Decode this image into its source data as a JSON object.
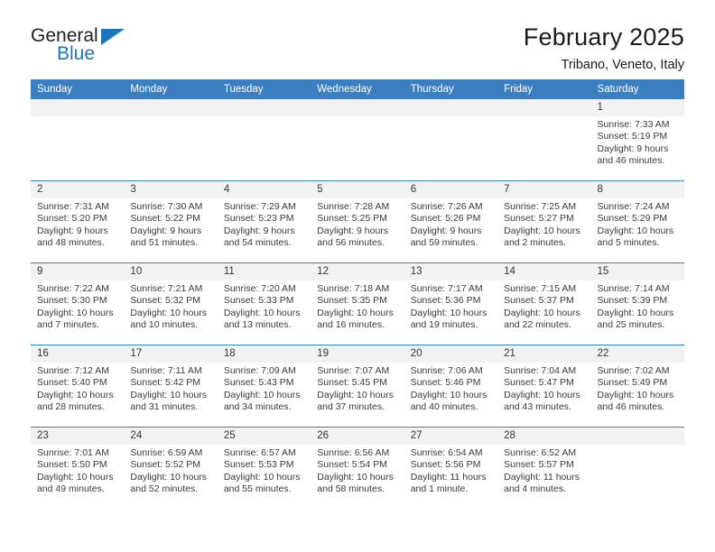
{
  "brand": {
    "name_part1": "General",
    "name_part2": "Blue",
    "triangle_color": "#1b75bb"
  },
  "header": {
    "title": "February 2025",
    "subtitle": "Tribano, Veneto, Italy"
  },
  "theme": {
    "header_blue": "#3c7fc1",
    "daynum_band": "#f2f2f2",
    "text": "#3a3a3a"
  },
  "weekday_headers": [
    "Sunday",
    "Monday",
    "Tuesday",
    "Wednesday",
    "Thursday",
    "Friday",
    "Saturday"
  ],
  "weeks": [
    [
      {
        "day": "",
        "sunrise": "",
        "sunset": "",
        "daylight1": "",
        "daylight2": "",
        "blank": true
      },
      {
        "day": "",
        "sunrise": "",
        "sunset": "",
        "daylight1": "",
        "daylight2": "",
        "blank": true
      },
      {
        "day": "",
        "sunrise": "",
        "sunset": "",
        "daylight1": "",
        "daylight2": "",
        "blank": true
      },
      {
        "day": "",
        "sunrise": "",
        "sunset": "",
        "daylight1": "",
        "daylight2": "",
        "blank": true
      },
      {
        "day": "",
        "sunrise": "",
        "sunset": "",
        "daylight1": "",
        "daylight2": "",
        "blank": true
      },
      {
        "day": "",
        "sunrise": "",
        "sunset": "",
        "daylight1": "",
        "daylight2": "",
        "blank": true
      },
      {
        "day": "1",
        "sunrise": "Sunrise: 7:33 AM",
        "sunset": "Sunset: 5:19 PM",
        "daylight1": "Daylight: 9 hours",
        "daylight2": "and 46 minutes.",
        "blank": false
      }
    ],
    [
      {
        "day": "2",
        "sunrise": "Sunrise: 7:31 AM",
        "sunset": "Sunset: 5:20 PM",
        "daylight1": "Daylight: 9 hours",
        "daylight2": "and 48 minutes.",
        "blank": false
      },
      {
        "day": "3",
        "sunrise": "Sunrise: 7:30 AM",
        "sunset": "Sunset: 5:22 PM",
        "daylight1": "Daylight: 9 hours",
        "daylight2": "and 51 minutes.",
        "blank": false
      },
      {
        "day": "4",
        "sunrise": "Sunrise: 7:29 AM",
        "sunset": "Sunset: 5:23 PM",
        "daylight1": "Daylight: 9 hours",
        "daylight2": "and 54 minutes.",
        "blank": false
      },
      {
        "day": "5",
        "sunrise": "Sunrise: 7:28 AM",
        "sunset": "Sunset: 5:25 PM",
        "daylight1": "Daylight: 9 hours",
        "daylight2": "and 56 minutes.",
        "blank": false
      },
      {
        "day": "6",
        "sunrise": "Sunrise: 7:26 AM",
        "sunset": "Sunset: 5:26 PM",
        "daylight1": "Daylight: 9 hours",
        "daylight2": "and 59 minutes.",
        "blank": false
      },
      {
        "day": "7",
        "sunrise": "Sunrise: 7:25 AM",
        "sunset": "Sunset: 5:27 PM",
        "daylight1": "Daylight: 10 hours",
        "daylight2": "and 2 minutes.",
        "blank": false
      },
      {
        "day": "8",
        "sunrise": "Sunrise: 7:24 AM",
        "sunset": "Sunset: 5:29 PM",
        "daylight1": "Daylight: 10 hours",
        "daylight2": "and 5 minutes.",
        "blank": false
      }
    ],
    [
      {
        "day": "9",
        "sunrise": "Sunrise: 7:22 AM",
        "sunset": "Sunset: 5:30 PM",
        "daylight1": "Daylight: 10 hours",
        "daylight2": "and 7 minutes.",
        "blank": false
      },
      {
        "day": "10",
        "sunrise": "Sunrise: 7:21 AM",
        "sunset": "Sunset: 5:32 PM",
        "daylight1": "Daylight: 10 hours",
        "daylight2": "and 10 minutes.",
        "blank": false
      },
      {
        "day": "11",
        "sunrise": "Sunrise: 7:20 AM",
        "sunset": "Sunset: 5:33 PM",
        "daylight1": "Daylight: 10 hours",
        "daylight2": "and 13 minutes.",
        "blank": false
      },
      {
        "day": "12",
        "sunrise": "Sunrise: 7:18 AM",
        "sunset": "Sunset: 5:35 PM",
        "daylight1": "Daylight: 10 hours",
        "daylight2": "and 16 minutes.",
        "blank": false
      },
      {
        "day": "13",
        "sunrise": "Sunrise: 7:17 AM",
        "sunset": "Sunset: 5:36 PM",
        "daylight1": "Daylight: 10 hours",
        "daylight2": "and 19 minutes.",
        "blank": false
      },
      {
        "day": "14",
        "sunrise": "Sunrise: 7:15 AM",
        "sunset": "Sunset: 5:37 PM",
        "daylight1": "Daylight: 10 hours",
        "daylight2": "and 22 minutes.",
        "blank": false
      },
      {
        "day": "15",
        "sunrise": "Sunrise: 7:14 AM",
        "sunset": "Sunset: 5:39 PM",
        "daylight1": "Daylight: 10 hours",
        "daylight2": "and 25 minutes.",
        "blank": false
      }
    ],
    [
      {
        "day": "16",
        "sunrise": "Sunrise: 7:12 AM",
        "sunset": "Sunset: 5:40 PM",
        "daylight1": "Daylight: 10 hours",
        "daylight2": "and 28 minutes.",
        "blank": false
      },
      {
        "day": "17",
        "sunrise": "Sunrise: 7:11 AM",
        "sunset": "Sunset: 5:42 PM",
        "daylight1": "Daylight: 10 hours",
        "daylight2": "and 31 minutes.",
        "blank": false
      },
      {
        "day": "18",
        "sunrise": "Sunrise: 7:09 AM",
        "sunset": "Sunset: 5:43 PM",
        "daylight1": "Daylight: 10 hours",
        "daylight2": "and 34 minutes.",
        "blank": false
      },
      {
        "day": "19",
        "sunrise": "Sunrise: 7:07 AM",
        "sunset": "Sunset: 5:45 PM",
        "daylight1": "Daylight: 10 hours",
        "daylight2": "and 37 minutes.",
        "blank": false
      },
      {
        "day": "20",
        "sunrise": "Sunrise: 7:06 AM",
        "sunset": "Sunset: 5:46 PM",
        "daylight1": "Daylight: 10 hours",
        "daylight2": "and 40 minutes.",
        "blank": false
      },
      {
        "day": "21",
        "sunrise": "Sunrise: 7:04 AM",
        "sunset": "Sunset: 5:47 PM",
        "daylight1": "Daylight: 10 hours",
        "daylight2": "and 43 minutes.",
        "blank": false
      },
      {
        "day": "22",
        "sunrise": "Sunrise: 7:02 AM",
        "sunset": "Sunset: 5:49 PM",
        "daylight1": "Daylight: 10 hours",
        "daylight2": "and 46 minutes.",
        "blank": false
      }
    ],
    [
      {
        "day": "23",
        "sunrise": "Sunrise: 7:01 AM",
        "sunset": "Sunset: 5:50 PM",
        "daylight1": "Daylight: 10 hours",
        "daylight2": "and 49 minutes.",
        "blank": false
      },
      {
        "day": "24",
        "sunrise": "Sunrise: 6:59 AM",
        "sunset": "Sunset: 5:52 PM",
        "daylight1": "Daylight: 10 hours",
        "daylight2": "and 52 minutes.",
        "blank": false
      },
      {
        "day": "25",
        "sunrise": "Sunrise: 6:57 AM",
        "sunset": "Sunset: 5:53 PM",
        "daylight1": "Daylight: 10 hours",
        "daylight2": "and 55 minutes.",
        "blank": false
      },
      {
        "day": "26",
        "sunrise": "Sunrise: 6:56 AM",
        "sunset": "Sunset: 5:54 PM",
        "daylight1": "Daylight: 10 hours",
        "daylight2": "and 58 minutes.",
        "blank": false
      },
      {
        "day": "27",
        "sunrise": "Sunrise: 6:54 AM",
        "sunset": "Sunset: 5:56 PM",
        "daylight1": "Daylight: 11 hours",
        "daylight2": "and 1 minute.",
        "blank": false
      },
      {
        "day": "28",
        "sunrise": "Sunrise: 6:52 AM",
        "sunset": "Sunset: 5:57 PM",
        "daylight1": "Daylight: 11 hours",
        "daylight2": "and 4 minutes.",
        "blank": false
      },
      {
        "day": "",
        "sunrise": "",
        "sunset": "",
        "daylight1": "",
        "daylight2": "",
        "blank": true
      }
    ]
  ]
}
